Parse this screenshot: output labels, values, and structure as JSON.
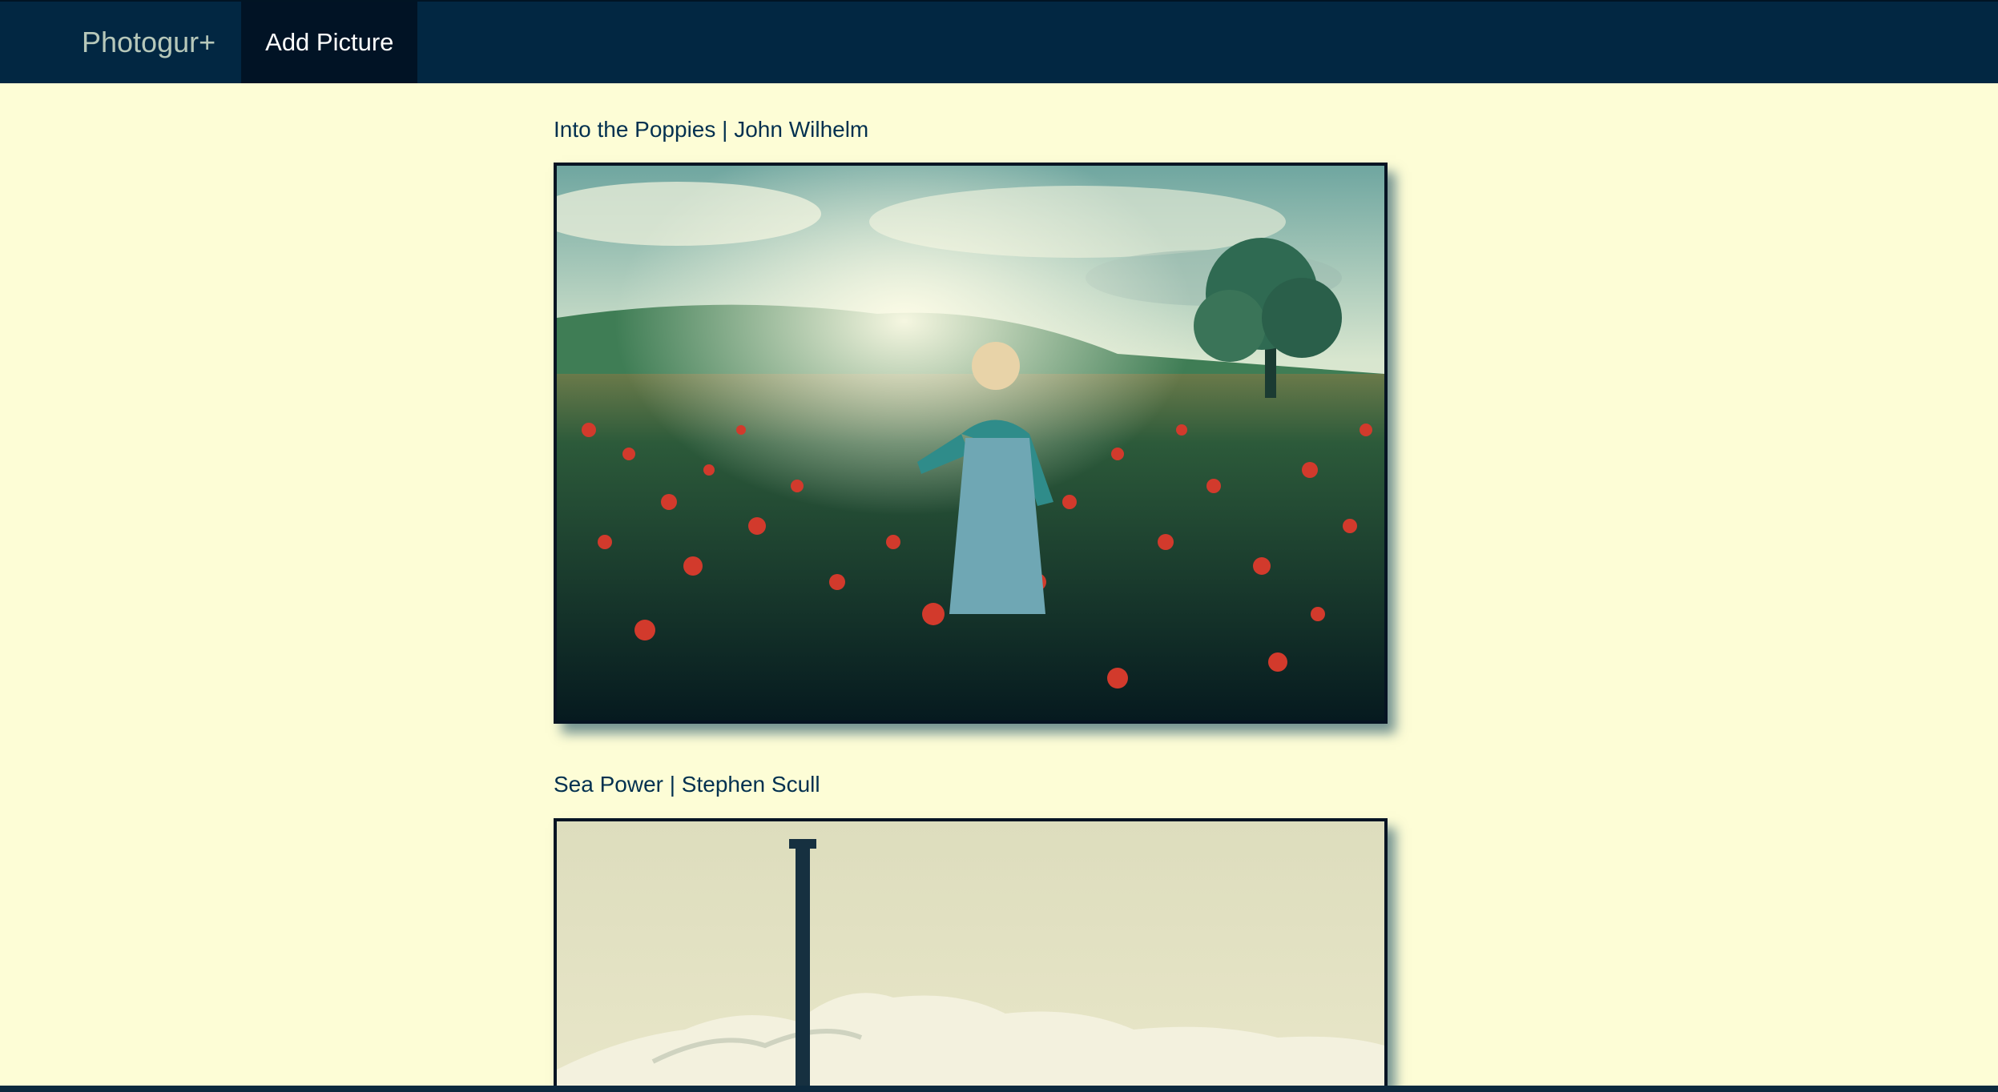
{
  "navbar": {
    "brand": "Photogur+",
    "add_picture_label": "Add Picture"
  },
  "posts": [
    {
      "title": "Into the Poppies | John Wilhelm"
    },
    {
      "title": "Sea Power | Stephen Scull"
    }
  ]
}
